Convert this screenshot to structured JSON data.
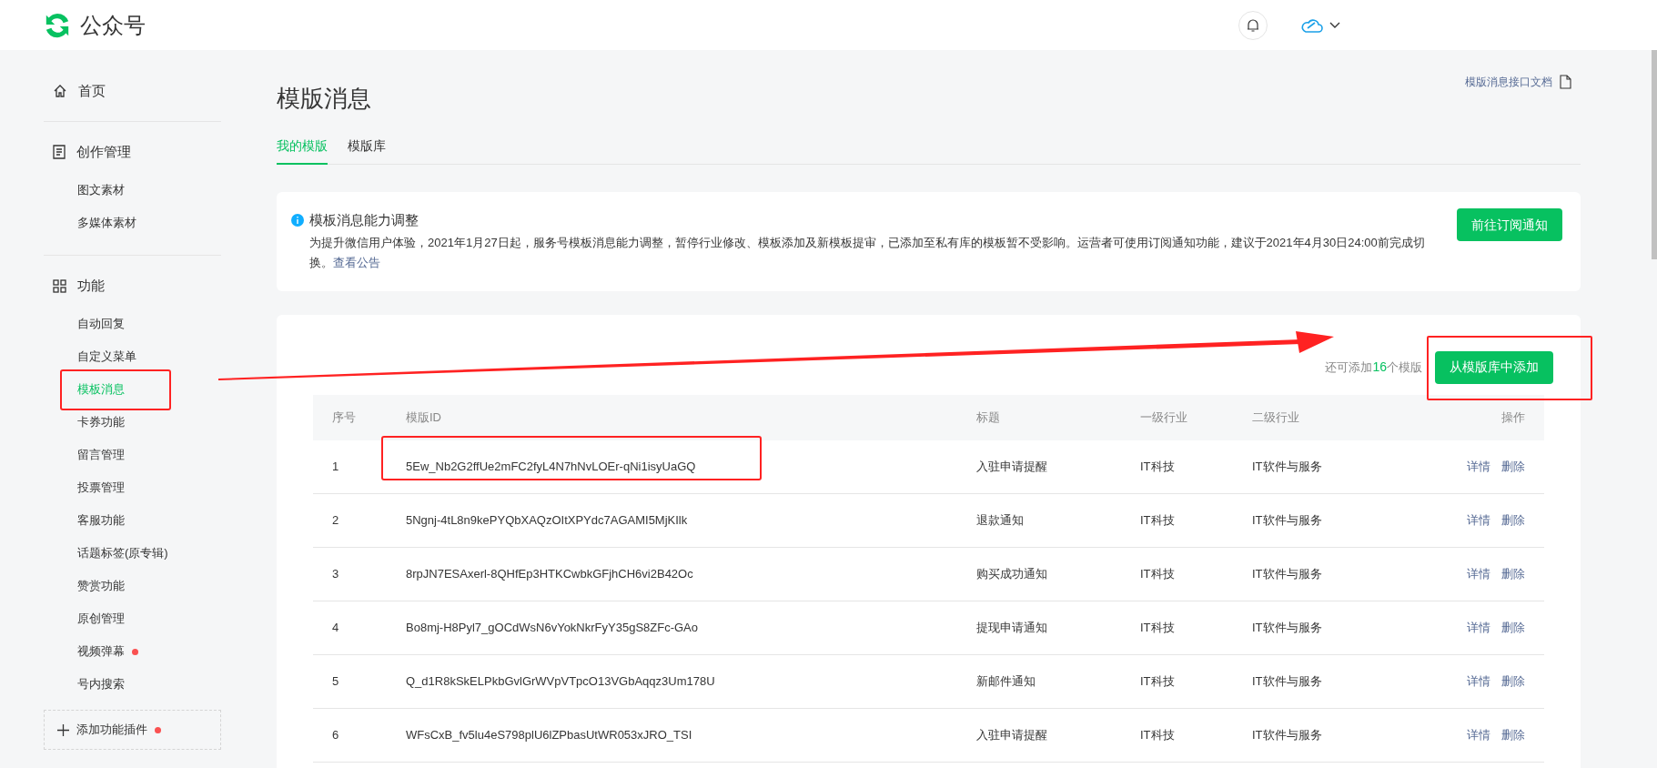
{
  "header": {
    "logo_text": "公众号"
  },
  "sidebar": {
    "groups": [
      {
        "kind": "home",
        "label": "首页"
      },
      {
        "kind": "document",
        "label": "创作管理",
        "items": [
          {
            "label": "图文素材",
            "selected": false,
            "dot": false,
            "highlighted": false
          },
          {
            "label": "多媒体素材",
            "selected": false,
            "dot": false,
            "highlighted": false
          }
        ]
      },
      {
        "kind": "grid",
        "label": "功能",
        "items": [
          {
            "label": "自动回复",
            "selected": false,
            "dot": false,
            "highlighted": false
          },
          {
            "label": "自定义菜单",
            "selected": false,
            "dot": false,
            "highlighted": false
          },
          {
            "label": "模板消息",
            "selected": true,
            "dot": false,
            "highlighted": true
          },
          {
            "label": "卡券功能",
            "selected": false,
            "dot": false,
            "highlighted": false
          },
          {
            "label": "留言管理",
            "selected": false,
            "dot": false,
            "highlighted": false
          },
          {
            "label": "投票管理",
            "selected": false,
            "dot": false,
            "highlighted": false
          },
          {
            "label": "客服功能",
            "selected": false,
            "dot": false,
            "highlighted": false
          },
          {
            "label": "话题标签(原专辑)",
            "selected": false,
            "dot": false,
            "highlighted": false
          },
          {
            "label": "赞赏功能",
            "selected": false,
            "dot": false,
            "highlighted": false
          },
          {
            "label": "原创管理",
            "selected": false,
            "dot": false,
            "highlighted": false
          },
          {
            "label": "视频弹幕",
            "selected": false,
            "dot": true,
            "highlighted": false
          },
          {
            "label": "号内搜索",
            "selected": false,
            "dot": false,
            "highlighted": false
          }
        ]
      }
    ],
    "add_plugin": {
      "label": "添加功能插件",
      "dot": true
    }
  },
  "page": {
    "title": "模版消息",
    "doc_link": "模版消息接口文档",
    "tabs": [
      {
        "label": "我的模版",
        "selected": true
      },
      {
        "label": "模版库",
        "selected": false
      }
    ]
  },
  "notice": {
    "title": "模板消息能力调整",
    "body": "为提升微信用户体验，2021年1月27日起，服务号模板消息能力调整，暂停行业修改、模板添加及新模板提审，已添加至私有库的模板暂不受影响。运营者可使用订阅通知功能，建议于2021年4月30日24:00前完成切换。",
    "link": "查看公告",
    "button": "前往订阅通知"
  },
  "templates": {
    "remaining_prefix": "还可添加",
    "remaining_count": "16",
    "remaining_suffix": "个模版",
    "add_button": {
      "label": "从模版库中添加",
      "highlighted": true
    },
    "columns": [
      "序号",
      "模版ID",
      "标题",
      "一级行业",
      "二级行业",
      "操作"
    ],
    "rows": [
      {
        "index": "1",
        "id": "5Ew_Nb2G2ffUe2mFC2fyL4N7hNvLOEr-qNi1isyUaGQ",
        "title": "入驻申请提醒",
        "industry_1": "IT科技",
        "industry_2": "IT软件与服务",
        "actions": [
          "详情",
          "删除"
        ],
        "highlighted": true
      },
      {
        "index": "2",
        "id": "5Ngnj-4tL8n9kePYQbXAQzOItXPYdc7AGAMI5MjKIlk",
        "title": "退款通知",
        "industry_1": "IT科技",
        "industry_2": "IT软件与服务",
        "actions": [
          "详情",
          "删除"
        ],
        "highlighted": false
      },
      {
        "index": "3",
        "id": "8rpJN7ESAxerl-8QHfEp3HTKCwbkGFjhCH6vi2B42Oc",
        "title": "购买成功通知",
        "industry_1": "IT科技",
        "industry_2": "IT软件与服务",
        "actions": [
          "详情",
          "删除"
        ],
        "highlighted": false
      },
      {
        "index": "4",
        "id": "Bo8mj-H8Pyl7_gOCdWsN6vYokNkrFyY35gS8ZFc-GAo",
        "title": "提现申请通知",
        "industry_1": "IT科技",
        "industry_2": "IT软件与服务",
        "actions": [
          "详情",
          "删除"
        ],
        "highlighted": false
      },
      {
        "index": "5",
        "id": "Q_d1R8kSkELPkbGvlGrWVpVTpcO13VGbAqqz3Um178U",
        "title": "新邮件通知",
        "industry_1": "IT科技",
        "industry_2": "IT软件与服务",
        "actions": [
          "详情",
          "删除"
        ],
        "highlighted": false
      },
      {
        "index": "6",
        "id": "WFsCxB_fv5lu4eS798plU6lZPbasUtWR053xJRO_TSI",
        "title": "入驻申请提醒",
        "industry_1": "IT科技",
        "industry_2": "IT软件与服务",
        "actions": [
          "详情",
          "删除"
        ],
        "highlighted": false
      }
    ]
  }
}
